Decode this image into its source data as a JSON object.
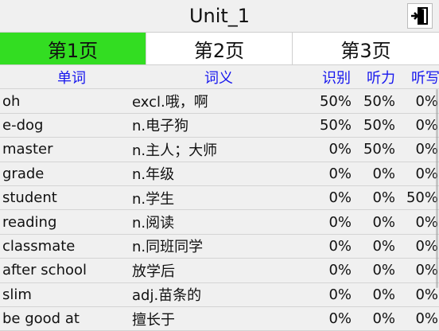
{
  "header": {
    "title": "Unit_1",
    "exit_icon": "exit-door-icon"
  },
  "tabs": [
    {
      "label": "第1页",
      "active": true
    },
    {
      "label": "第2页",
      "active": false
    },
    {
      "label": "第3页",
      "active": false
    }
  ],
  "table": {
    "headers": {
      "word": "单词",
      "meaning": "词义",
      "recognize": "识别",
      "listen": "听力",
      "dictation": "听写"
    },
    "rows": [
      {
        "word": "oh",
        "meaning": "excl.哦，啊",
        "recognize": "50%",
        "listen": "50%",
        "dictation": "0%"
      },
      {
        "word": "e-dog",
        "meaning": "n.电子狗",
        "recognize": "50%",
        "listen": "50%",
        "dictation": "0%"
      },
      {
        "word": "master",
        "meaning": "n.主人；大师",
        "recognize": "0%",
        "listen": "50%",
        "dictation": "0%"
      },
      {
        "word": "grade",
        "meaning": "n.年级",
        "recognize": "0%",
        "listen": "0%",
        "dictation": "0%"
      },
      {
        "word": "student",
        "meaning": "n.学生",
        "recognize": "0%",
        "listen": "0%",
        "dictation": "50%"
      },
      {
        "word": "reading",
        "meaning": "n.阅读",
        "recognize": "0%",
        "listen": "0%",
        "dictation": "0%"
      },
      {
        "word": "classmate",
        "meaning": "n.同班同学",
        "recognize": "0%",
        "listen": "0%",
        "dictation": "0%"
      },
      {
        "word": "after school",
        "meaning": "放学后",
        "recognize": "0%",
        "listen": "0%",
        "dictation": "0%"
      },
      {
        "word": "slim",
        "meaning": "adj.苗条的",
        "recognize": "0%",
        "listen": "0%",
        "dictation": "0%"
      },
      {
        "word": "be good at",
        "meaning": "擅长于",
        "recognize": "0%",
        "listen": "0%",
        "dictation": "0%"
      }
    ]
  },
  "colors": {
    "active_tab": "#33dd22",
    "header_text": "#1616ee",
    "background": "#f0f0f0"
  }
}
